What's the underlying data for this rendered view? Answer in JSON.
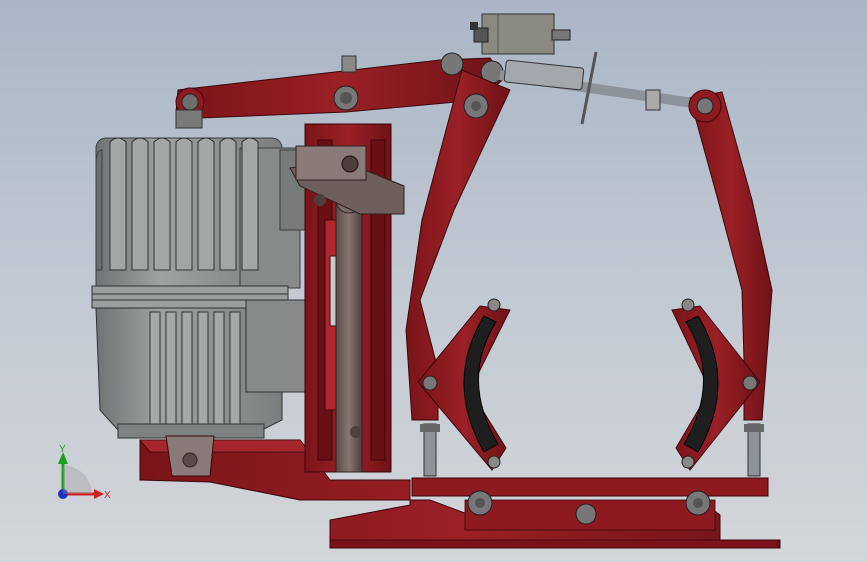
{
  "viewport": {
    "background_top": "#aab6c6",
    "background_bottom": "#d3d6da"
  },
  "colors": {
    "frame_red": "#8c1a1f",
    "frame_dark": "#5e1014",
    "frame_edge": "#3a070a",
    "motor_gray": "#8d9191",
    "motor_dark": "#5e6262",
    "lining_black": "#1e1e1e",
    "steel": "#9aa0a8"
  },
  "triad": {
    "x_label": "X",
    "y_label": "Y",
    "x_color": "#d02020",
    "y_color": "#1aa01a",
    "z_color": "#2030c0"
  }
}
